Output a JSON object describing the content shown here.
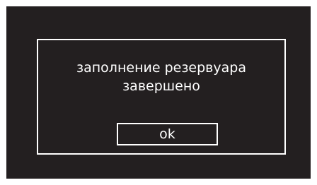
{
  "colors": {
    "background": "#231f20",
    "foreground": "#ffffff"
  },
  "dialog": {
    "message_line1": "заполнение резервуара",
    "message_line2": "завершено",
    "ok_label": "ok"
  }
}
